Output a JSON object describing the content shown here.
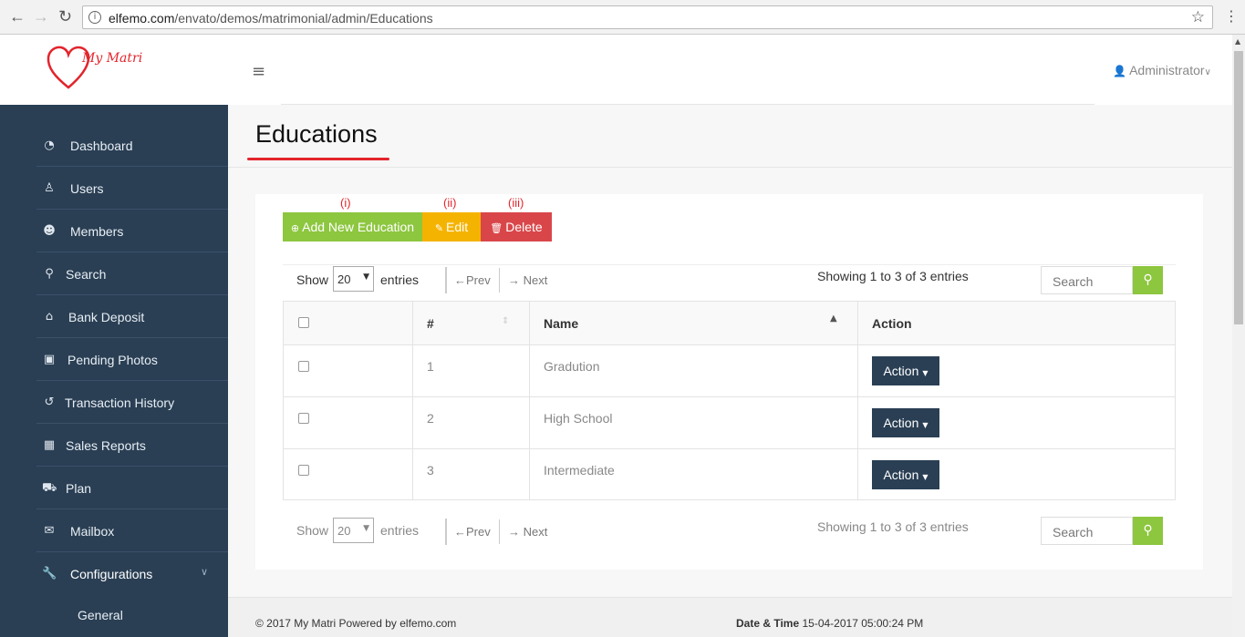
{
  "browser": {
    "url_host": "elfemo.com",
    "url_path": "/envato/demos/matrimonial/admin/Educations",
    "back_icon": "arrow-left-icon",
    "forward_icon": "arrow-right-icon",
    "reload_icon": "reload-icon"
  },
  "header": {
    "logo_text": "My Matri",
    "user_label": "Administrator",
    "accent": "#e3242b"
  },
  "sidebar": {
    "items": [
      {
        "label": "Dashboard",
        "icon": "dashboard-icon"
      },
      {
        "label": "Users",
        "icon": "user-icon"
      },
      {
        "label": "Members",
        "icon": "members-icon"
      },
      {
        "label": "Search",
        "icon": "search-icon"
      },
      {
        "label": "Bank Deposit",
        "icon": "bank-icon"
      },
      {
        "label": "Pending Photos",
        "icon": "image-icon"
      },
      {
        "label": "Transaction History",
        "icon": "history-icon"
      },
      {
        "label": "Sales Reports",
        "icon": "table-icon"
      },
      {
        "label": "Plan",
        "icon": "cart-icon"
      },
      {
        "label": "Mailbox",
        "icon": "envelope-icon"
      },
      {
        "label": "Configurations",
        "icon": "wrench-icon"
      }
    ],
    "sub_item": "General"
  },
  "page": {
    "title": "Educations",
    "annotations": [
      "(i)",
      "(ii)",
      "(iii)"
    ],
    "buttons": {
      "add": "Add New Education",
      "edit": "Edit",
      "delete": "Delete"
    }
  },
  "controls": {
    "show": "Show",
    "page_size": "20",
    "entries": "entries",
    "prev": "←Prev",
    "next": "→ Next",
    "showing": "Showing 1 to 3 of 3 entries",
    "search_placeholder": "Search"
  },
  "table": {
    "columns": [
      "#",
      "Name",
      "Action"
    ],
    "rows": [
      {
        "num": "1",
        "name": "Gradution",
        "action": "Action"
      },
      {
        "num": "2",
        "name": "High School",
        "action": "Action"
      },
      {
        "num": "3",
        "name": "Intermediate",
        "action": "Action"
      }
    ]
  },
  "footer": {
    "copyright": "© 2017 My Matri Powered by elfemo.com",
    "datetime_label": "Date & Time",
    "datetime_value": "15-04-2017 05:00:24 PM"
  }
}
